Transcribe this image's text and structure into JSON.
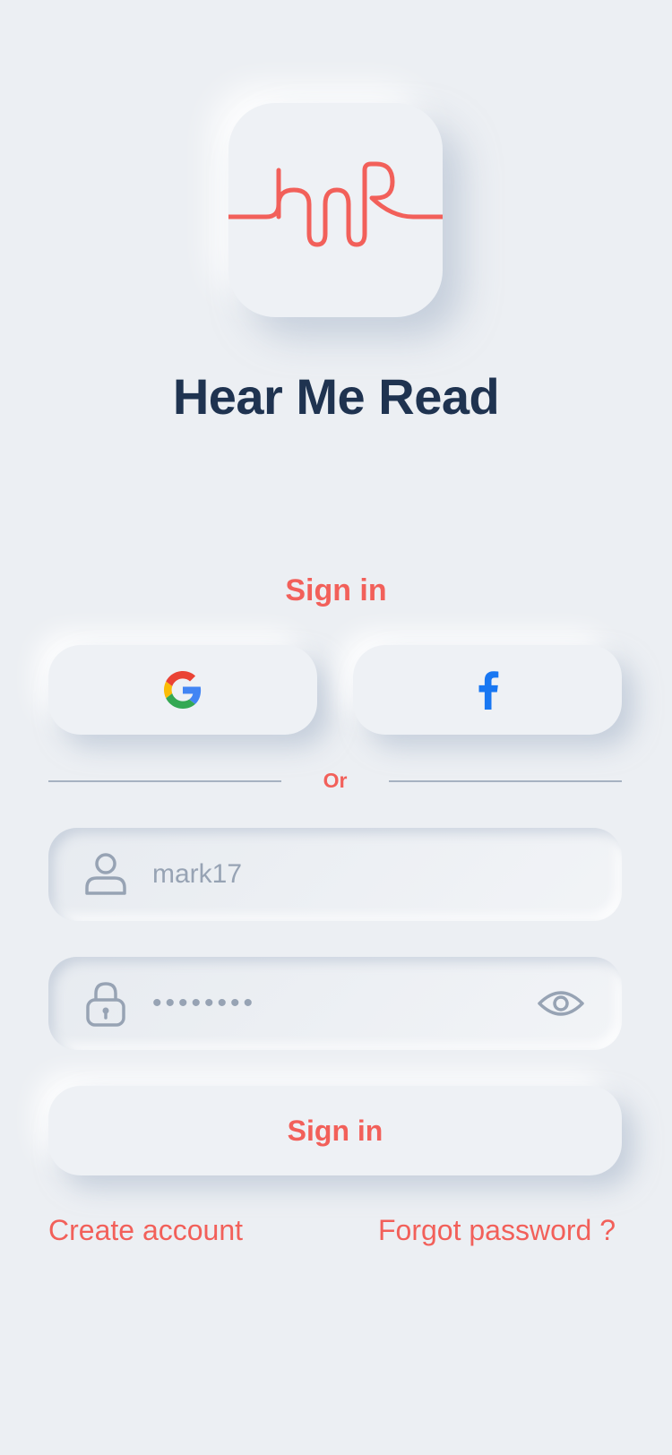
{
  "app": {
    "title": "Hear Me Read",
    "logo_icon": "hmr-logo-icon"
  },
  "sign_in": {
    "heading": "Sign in",
    "social": {
      "google_icon": "google-icon",
      "facebook_icon": "facebook-icon"
    },
    "divider_text": "Or",
    "username": {
      "icon": "user-icon",
      "value": "mark17"
    },
    "password": {
      "icon": "lock-icon",
      "value": "••••••••",
      "toggle_icon": "eye-icon"
    },
    "submit_label": "Sign in",
    "create_account_label": "Create account",
    "forgot_password_label": "Forgot password ?"
  },
  "colors": {
    "background": "#ECEFF3",
    "accent": "#F2605A",
    "title": "#1F3350",
    "muted": "#97A3B4",
    "facebook": "#1877F2"
  }
}
